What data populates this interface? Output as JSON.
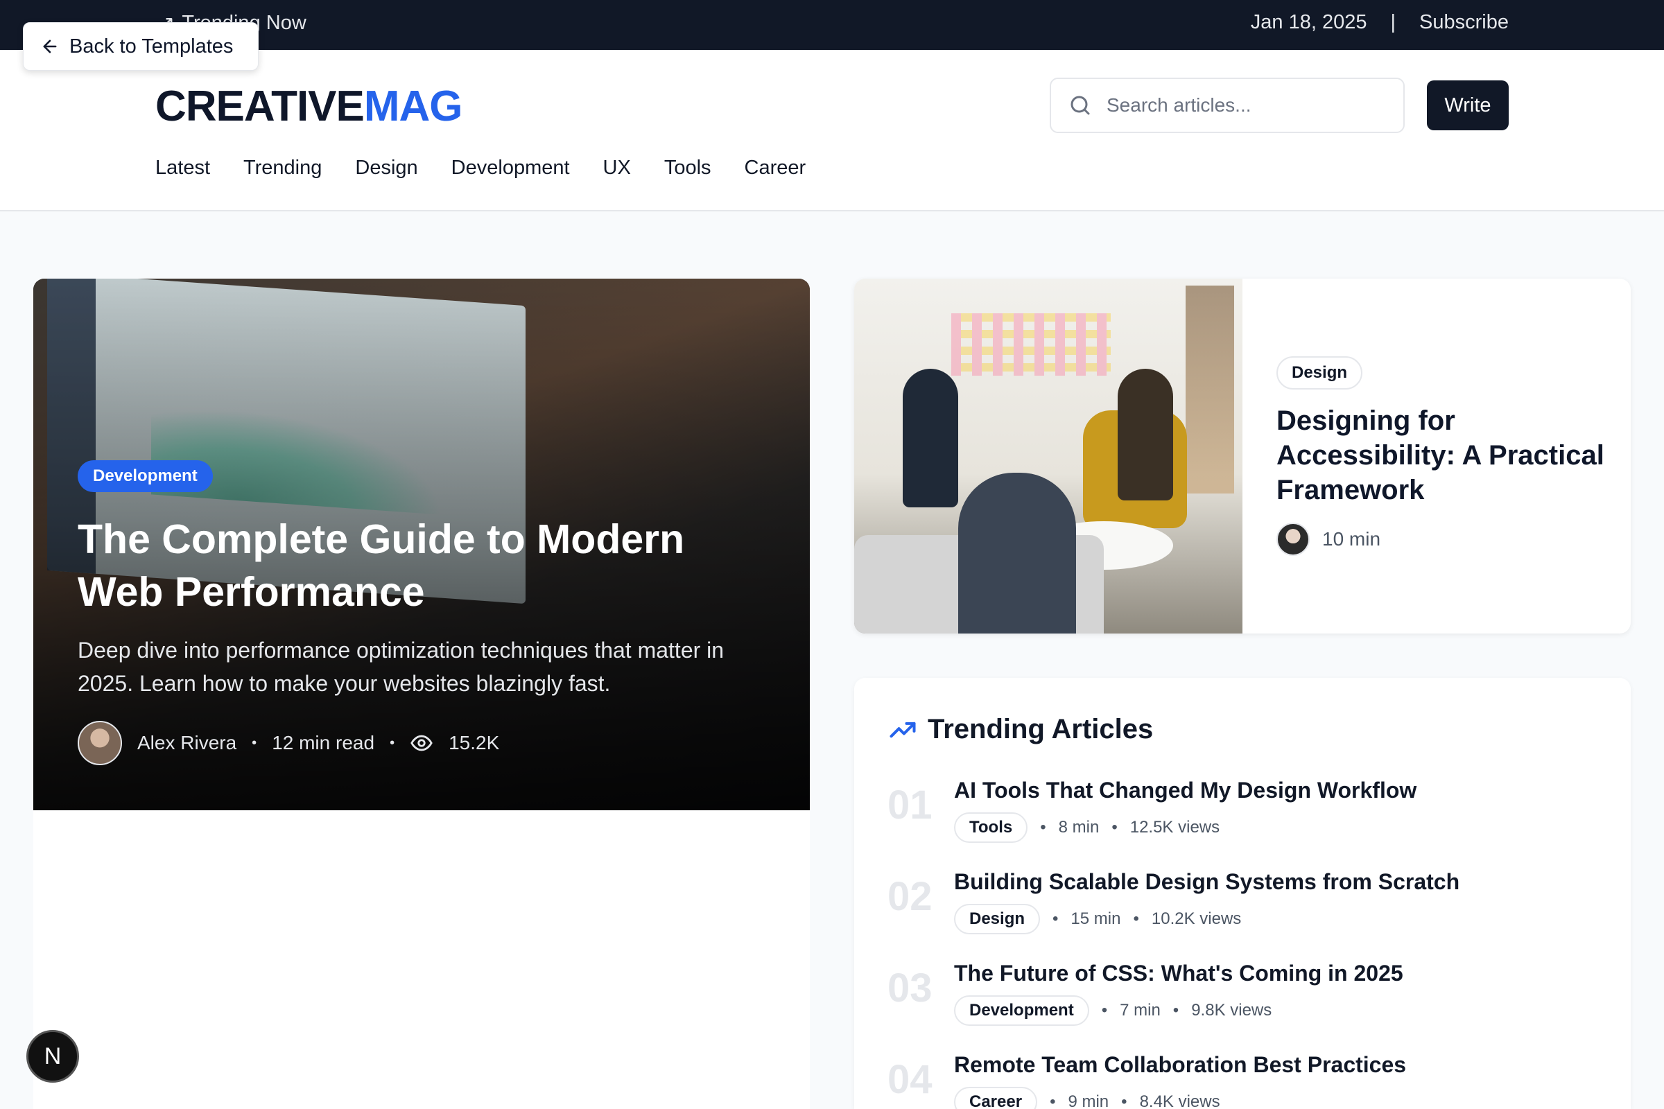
{
  "topbar": {
    "trending_label": "Trending Now",
    "date": "Jan 18, 2025",
    "separator": "|",
    "subscribe": "Subscribe"
  },
  "back_button": {
    "label": "Back to Templates"
  },
  "logo": {
    "part1": "CREATIVE",
    "part2": "MAG"
  },
  "search": {
    "placeholder": "Search articles..."
  },
  "write_button": {
    "label": "Write"
  },
  "nav": {
    "items": [
      "Latest",
      "Trending",
      "Design",
      "Development",
      "UX",
      "Tools",
      "Career"
    ]
  },
  "hero": {
    "category": "Development",
    "title": "The Complete Guide to Modern Web Performance",
    "description": "Deep dive into performance optimization techniques that matter in 2025. Learn how to make your websites blazingly fast.",
    "author": "Alex Rivera",
    "read_time": "12 min read",
    "views": "15.2K"
  },
  "featured": {
    "category": "Design",
    "title": "Designing for Accessibility: A Practical Framework",
    "read_time": "10 min"
  },
  "trending": {
    "heading": "Trending Articles",
    "items": [
      {
        "num": "01",
        "title": "AI Tools That Changed My Design Workflow",
        "tag": "Tools",
        "time": "8 min",
        "views": "12.5K views"
      },
      {
        "num": "02",
        "title": "Building Scalable Design Systems from Scratch",
        "tag": "Design",
        "time": "15 min",
        "views": "10.2K views"
      },
      {
        "num": "03",
        "title": "The Future of CSS: What's Coming in 2025",
        "tag": "Development",
        "time": "7 min",
        "views": "9.8K views"
      },
      {
        "num": "04",
        "title": "Remote Team Collaboration Best Practices",
        "tag": "Career",
        "time": "9 min",
        "views": "8.4K views"
      }
    ]
  },
  "fab": {
    "label": "N"
  },
  "colors": {
    "accent": "#2563eb",
    "dark": "#111827",
    "muted": "#6b7280"
  }
}
